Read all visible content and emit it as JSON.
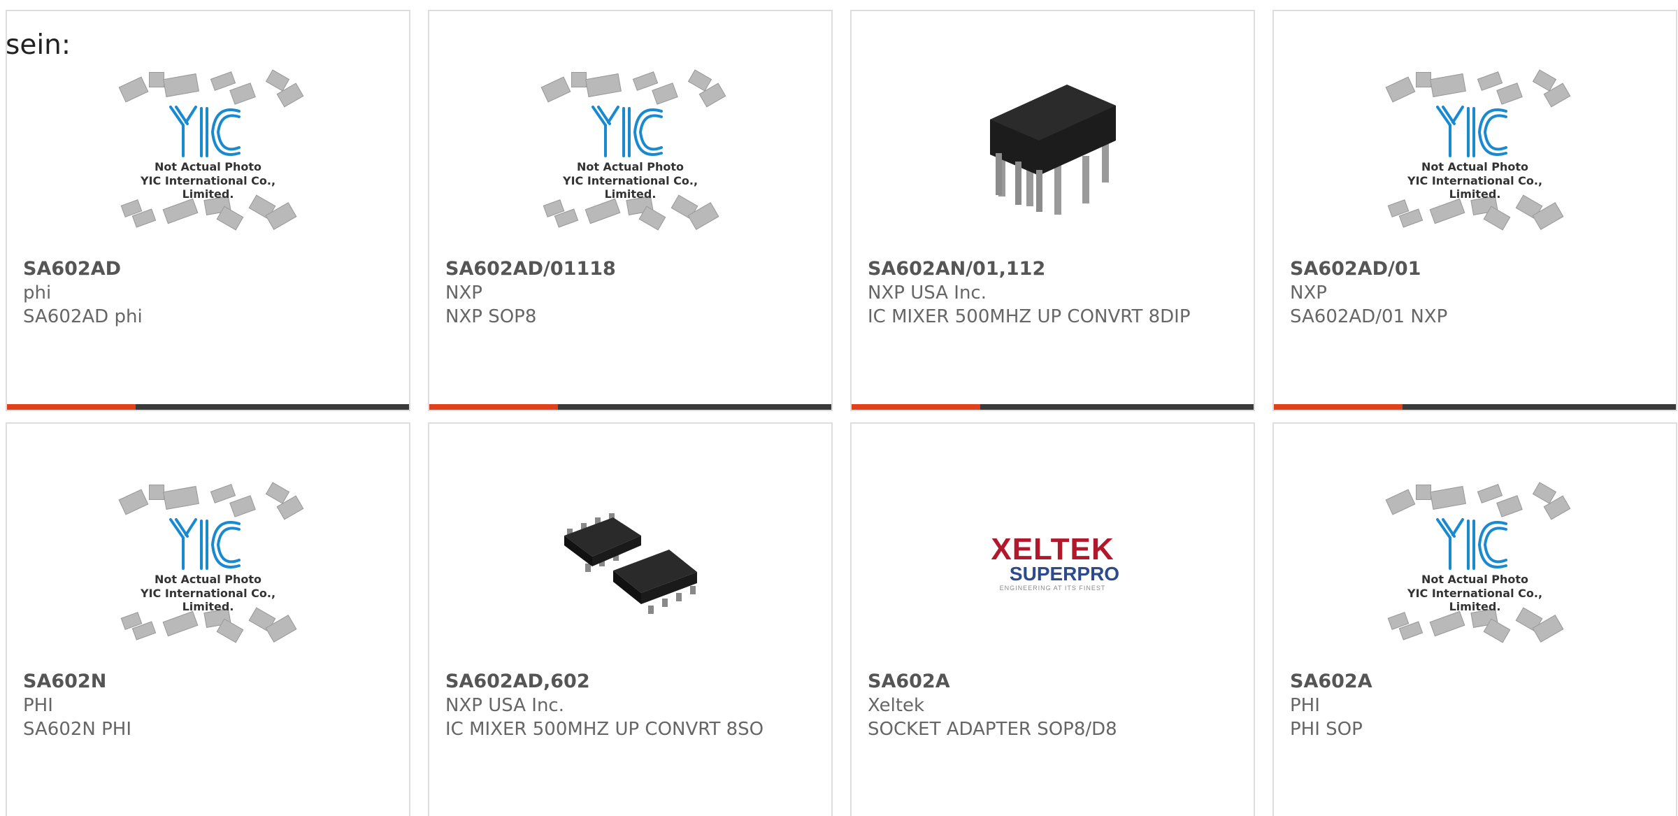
{
  "lead_text": "sein:",
  "placeholder": {
    "line1": "Not Actual Photo",
    "line2": "YIC International Co., Limited."
  },
  "brand_logo": {
    "name": "XELTEK",
    "sub": "SUPERPRO",
    "tagline": "ENGINEERING AT ITS FINEST"
  },
  "colors": {
    "accent": "#e0401a",
    "bar": "#3a3a3a",
    "logo_blue": "#1a8ad0",
    "xeltek_red": "#b2182b",
    "xeltek_blue": "#2c4a8c"
  },
  "products": [
    {
      "part": "SA602AD",
      "manufacturer": "phi",
      "description": "SA602AD phi",
      "image": "placeholder"
    },
    {
      "part": "SA602AD/01118",
      "manufacturer": "NXP",
      "description": "NXP SOP8",
      "image": "placeholder"
    },
    {
      "part": "SA602AN/01,112",
      "manufacturer": "NXP USA Inc.",
      "description": "IC MIXER 500MHZ UP CONVRT 8DIP",
      "image": "dip8-chip"
    },
    {
      "part": "SA602AD/01",
      "manufacturer": "NXP",
      "description": "SA602AD/01 NXP",
      "image": "placeholder"
    },
    {
      "part": "SA602N",
      "manufacturer": "PHI",
      "description": "SA602N PHI",
      "image": "placeholder"
    },
    {
      "part": "SA602AD,602",
      "manufacturer": "NXP USA Inc.",
      "description": "IC MIXER 500MHZ UP CONVRT 8SO",
      "image": "so8-chips"
    },
    {
      "part": "SA602A",
      "manufacturer": "Xeltek",
      "description": "SOCKET ADAPTER SOP8/D8",
      "image": "xeltek-logo"
    },
    {
      "part": "SA602A",
      "manufacturer": "PHI",
      "description": "PHI SOP",
      "image": "placeholder"
    }
  ]
}
